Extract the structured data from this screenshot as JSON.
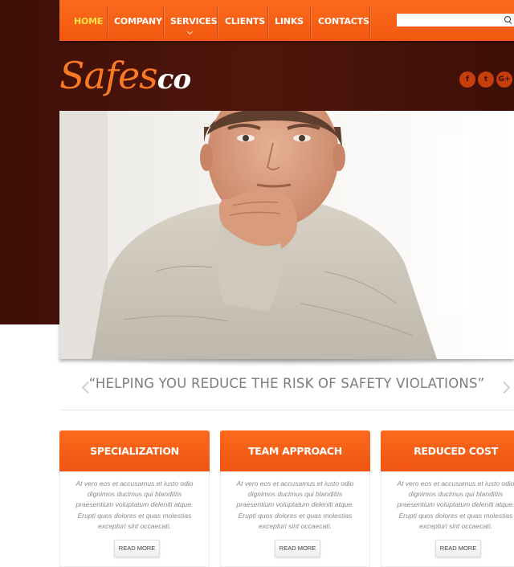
{
  "nav": {
    "items": [
      {
        "label": "HOME",
        "active": true
      },
      {
        "label": "COMPANY",
        "active": false
      },
      {
        "label": "SERVICES",
        "active": false,
        "has_dropdown": true
      },
      {
        "label": "CLIENTS",
        "active": false
      },
      {
        "label": "LINKS",
        "active": false
      },
      {
        "label": "CONTACTS",
        "active": false
      }
    ],
    "search": {
      "value": "",
      "placeholder": ""
    }
  },
  "logo": {
    "part1": "Safes",
    "part2": "co"
  },
  "social": [
    {
      "icon": "facebook-icon",
      "glyph": "f"
    },
    {
      "icon": "twitter-icon",
      "glyph": "t"
    },
    {
      "icon": "google-plus-icon",
      "glyph": "G+"
    }
  ],
  "slider": {
    "tagline": "“HELPING YOU REDUCE THE RISK OF SAFETY VIOLATIONS”"
  },
  "features": [
    {
      "title": "SPECIALIZATION",
      "text": "At vero eos et accusamus et iusto odio dignimos ducimus qui blanditiis praesentium voluptatum deleniti atque. Erupti quos dolores et quas molestias excepturi sint occaecati.",
      "button": "READ MORE"
    },
    {
      "title": "TEAM APPROACH",
      "text": "At vero eos et accusamus et iusto odio dignimos ducimus qui blanditiis praesentium voluptatum deleniti atque. Erupti quos dolores et quas molestias excepturi sint occaecati.",
      "button": "READ MORE"
    },
    {
      "title": "REDUCED COST",
      "text": "At vero eos et accusamus et iusto odio dignimos ducimus qui blanditiis praesentium voluptatum deleniti atque. Erupti quos dolores et quas molestias excepturi sint occaecati.",
      "button": "READ MORE"
    }
  ],
  "colors": {
    "accent": "#f45c12",
    "active_nav": "#ffe14a",
    "header_bg": "#4a140a"
  }
}
